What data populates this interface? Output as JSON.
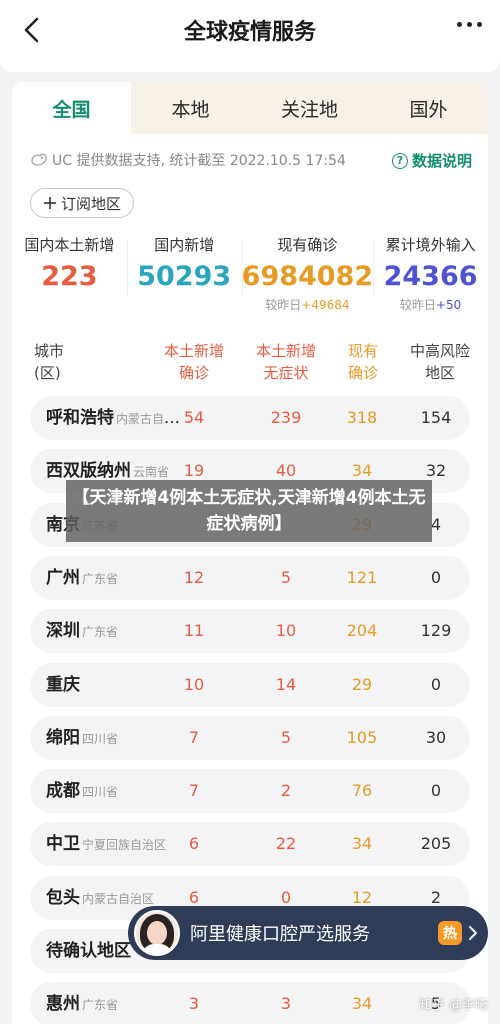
{
  "header": {
    "title": "全球疫情服务"
  },
  "tabs": [
    {
      "label": "全国",
      "active": true
    },
    {
      "label": "本地",
      "active": false
    },
    {
      "label": "关注地",
      "active": false
    },
    {
      "label": "国外",
      "active": false
    }
  ],
  "source": {
    "text": "UC 提供数据支持, 统计截至 2022.10.5 17:54",
    "explain_label": "数据说明"
  },
  "subscribe_label": "订阅地区",
  "stats": [
    {
      "label": "国内本土新增",
      "value": "223",
      "change_prefix": "",
      "change_value": "",
      "color": "#e65c41"
    },
    {
      "label": "国内新增",
      "value": "50293",
      "change_prefix": "",
      "change_value": "",
      "color": "#2aa6bf"
    },
    {
      "label": "现有确诊",
      "value": "6984082",
      "change_prefix": "较昨日",
      "change_value": "+49684",
      "color": "#e79b25"
    },
    {
      "label": "累计境外输入",
      "value": "24366",
      "change_prefix": "较昨日",
      "change_value": "+50",
      "color": "#5053d0"
    }
  ],
  "table": {
    "headers": {
      "city": "城市\n(区)",
      "local_confirmed": "本土新增\n确诊",
      "local_asymptomatic": "本土新增\n无症状",
      "current_confirmed": "现有\n确诊",
      "risk_areas": "中高风险\n地区"
    },
    "rows": [
      {
        "city": "呼和浩特",
        "province": "内蒙古自治区",
        "c1": "54",
        "c2": "239",
        "c3": "318",
        "c4": "154"
      },
      {
        "city": "西双版纳州",
        "province": "云南省",
        "c1": "19",
        "c2": "40",
        "c3": "34",
        "c4": "32"
      },
      {
        "city": "南京",
        "province": "江苏省",
        "c1": "",
        "c2": "",
        "c3": "29",
        "c4": "4"
      },
      {
        "city": "广州",
        "province": "广东省",
        "c1": "12",
        "c2": "5",
        "c3": "121",
        "c4": "0"
      },
      {
        "city": "深圳",
        "province": "广东省",
        "c1": "11",
        "c2": "10",
        "c3": "204",
        "c4": "129"
      },
      {
        "city": "重庆",
        "province": "",
        "c1": "10",
        "c2": "14",
        "c3": "29",
        "c4": "0"
      },
      {
        "city": "绵阳",
        "province": "四川省",
        "c1": "7",
        "c2": "5",
        "c3": "105",
        "c4": "30"
      },
      {
        "city": "成都",
        "province": "四川省",
        "c1": "7",
        "c2": "2",
        "c3": "76",
        "c4": "0"
      },
      {
        "city": "中卫",
        "province": "宁夏回族自治区",
        "c1": "6",
        "c2": "22",
        "c3": "34",
        "c4": "205"
      },
      {
        "city": "包头",
        "province": "内蒙古自治区",
        "c1": "6",
        "c2": "0",
        "c3": "12",
        "c4": "2"
      },
      {
        "city": "待确认地区",
        "province": "",
        "c1": "",
        "c2": "",
        "c3": "",
        "c4": ""
      },
      {
        "city": "惠州",
        "province": "广东省",
        "c1": "3",
        "c2": "3",
        "c3": "34",
        "c4": "5"
      }
    ]
  },
  "overlay_banner": "【天津新增4例本土无症状,天津新增4例本土无症状病例】",
  "ad": {
    "text": "阿里健康口腔严选服务",
    "badge": "热"
  },
  "watermark": "知乎 @李曦"
}
